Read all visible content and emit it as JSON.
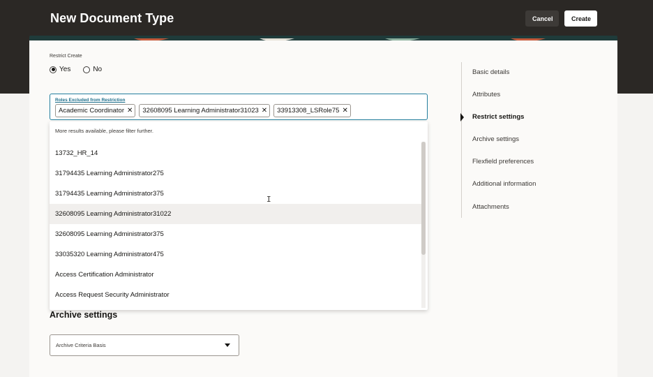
{
  "header": {
    "title": "New Document Type",
    "cancel_label": "Cancel",
    "create_label": "Create"
  },
  "restrict_create": {
    "label": "Restrict Create",
    "options": [
      "Yes",
      "No"
    ],
    "selected": "Yes"
  },
  "roles_field": {
    "label": "Roles Excluded from Restriction",
    "chips": [
      "Academic Coordinator",
      "32608095 Learning Administrator31023",
      "33913308_LSRole75"
    ]
  },
  "dropdown": {
    "hint": "More results available, please filter further.",
    "items": [
      "13732_HR_14",
      "31794435 Learning Administrator275",
      "31794435 Learning Administrator375",
      "32608095 Learning Administrator31022",
      "32608095 Learning Administrator375",
      "33035320 Learning Administrator475",
      "Access Certification Administrator",
      "Access Request Security Administrator"
    ],
    "hovered_index": 3
  },
  "archive": {
    "section_title": "Archive settings",
    "criteria_label": "Archive Criteria Basis"
  },
  "side_nav": {
    "items": [
      "Basic details",
      "Attributes",
      "Restrict settings",
      "Archive settings",
      "Flexfield preferences",
      "Additional information",
      "Attachments"
    ],
    "active_index": 2
  },
  "colors": {
    "header_bg": "#2b2825",
    "focus_border": "#227e9e",
    "hover_row": "#f1efed"
  }
}
